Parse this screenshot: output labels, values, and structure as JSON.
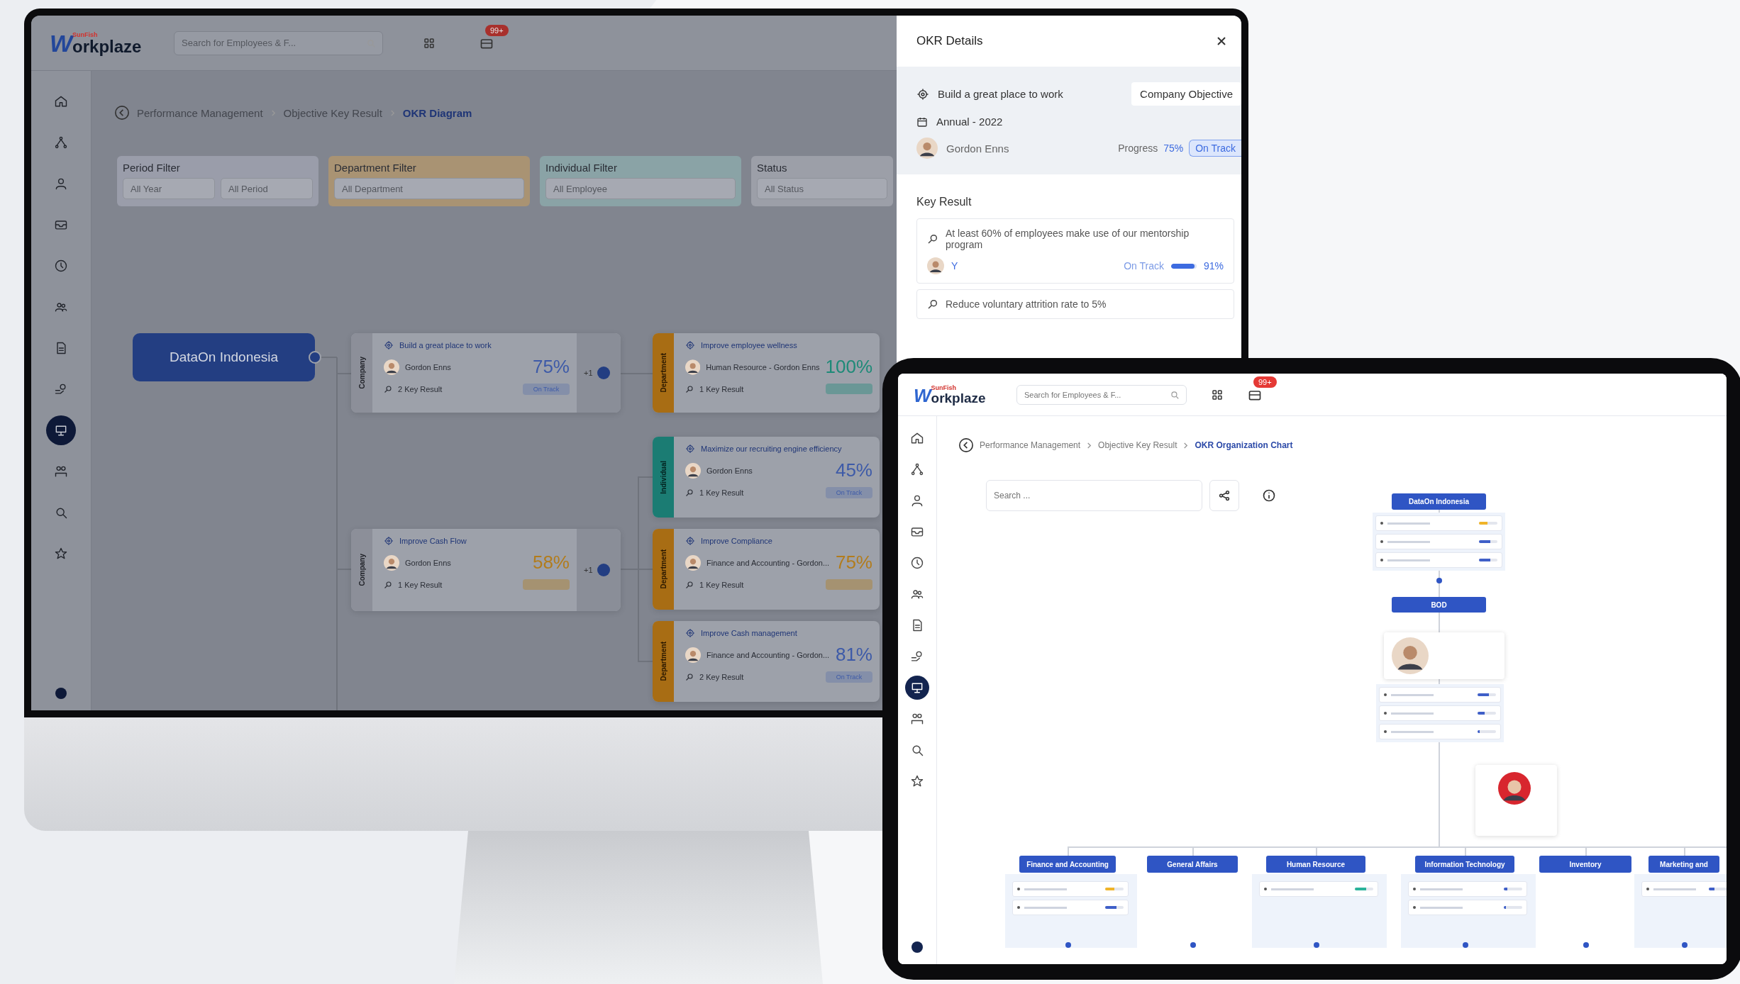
{
  "monitor": {
    "header": {
      "logo": {
        "mark": "W",
        "wordmark": "orkplaze",
        "brand": "SunFish"
      },
      "search": {
        "placeholder": "Search for Employees & F..."
      },
      "notification_badge": "99+"
    },
    "sidebar": {
      "items": [
        {
          "kind": "home",
          "selected": false
        },
        {
          "kind": "network",
          "selected": false
        },
        {
          "kind": "person",
          "selected": false
        },
        {
          "kind": "inbox",
          "selected": false
        },
        {
          "kind": "clock",
          "selected": false
        },
        {
          "kind": "team",
          "selected": false
        },
        {
          "kind": "document",
          "selected": false
        },
        {
          "kind": "coins",
          "selected": false
        },
        {
          "kind": "presentation",
          "selected": true
        },
        {
          "kind": "people",
          "selected": false
        },
        {
          "kind": "magnifier",
          "selected": false
        },
        {
          "kind": "star",
          "selected": false
        }
      ]
    },
    "breadcrumb": [
      "Performance Management",
      "Objective Key Result",
      "OKR Diagram"
    ],
    "filters": [
      {
        "label": "Period Filter",
        "color": "#9a9daa",
        "selects": [
          "All Year",
          "All Period"
        ]
      },
      {
        "label": "Department Filter",
        "color": "#a99373",
        "selects": [
          "All Department"
        ]
      },
      {
        "label": "Individual Filter",
        "color": "#8aa3a6",
        "selects": [
          "All Employee"
        ]
      },
      {
        "label": "Status",
        "color": "#9c9fa8",
        "selects": [
          "All Status"
        ]
      }
    ],
    "diagram": {
      "root": "DataOn Indonesia",
      "objectives": [
        {
          "kind": "company",
          "tier_label": "Company",
          "title": "Build a great place to work",
          "owner": "Gordon Enns",
          "percent": "75%",
          "key_results": "2 Key Result",
          "color": "#3d5aa8",
          "status_label": "On Track",
          "children_count": "+1",
          "children": [
            {
              "kind": "department",
              "tier_label": "Department",
              "title": "Improve employee wellness",
              "owner": "Human Resource - Gordon Enns",
              "percent": "100%",
              "key_results": "1 Key Result",
              "color": "#1e8a78"
            }
          ]
        },
        {
          "kind": "company",
          "tier_label": "Company",
          "title": "Improve Cash Flow",
          "owner": "Gordon Enns",
          "percent": "58%",
          "key_results": "1 Key Result",
          "color": "#b27c1c",
          "children_count": "+1",
          "children": [
            {
              "kind": "individual",
              "tier_label": "Individual",
              "title": "Maximize our recruiting engine efficiency",
              "owner": "Gordon Enns",
              "percent": "45%",
              "key_results": "1 Key Result",
              "color": "#3d5aa8",
              "status_label": "On Track"
            },
            {
              "kind": "department",
              "tier_label": "Department",
              "title": "Improve Compliance",
              "owner": "Finance and Accounting - Gordon...",
              "percent": "75%",
              "key_results": "1 Key Result",
              "color": "#b27c1c"
            },
            {
              "kind": "department",
              "tier_label": "Department",
              "title": "Improve Cash management",
              "owner": "Finance and Accounting - Gordon...",
              "percent": "81%",
              "key_results": "2 Key Result",
              "color": "#3d5aa8",
              "status_label": "On Track"
            }
          ]
        }
      ]
    },
    "details": {
      "title": "OKR Details",
      "objective": "Build a great place to work",
      "tag": "Company Objective",
      "period": "Annual - 2022",
      "owner": "Gordon Enns",
      "progress_label": "Progress",
      "progress": "75%",
      "status_label": "On Track",
      "section": "Key Result",
      "key_results": [
        {
          "text": "At least 60% of employees make use of our mentorship program",
          "owner_initial": "Y",
          "status_label": "On Track",
          "level": 0.91,
          "percent": "91%"
        },
        {
          "text": "Reduce voluntary attrition rate to 5%"
        }
      ]
    }
  },
  "tablet": {
    "header": {
      "logo": {
        "mark": "W",
        "wordmark": "orkplaze",
        "brand": "SunFish"
      },
      "search": {
        "placeholder": "Search for Employees & F..."
      },
      "notification_badge": "99+"
    },
    "sidebar": {
      "items": [
        {
          "kind": "home",
          "selected": false
        },
        {
          "kind": "network",
          "selected": false
        },
        {
          "kind": "person",
          "selected": false
        },
        {
          "kind": "inbox",
          "selected": false
        },
        {
          "kind": "clock",
          "selected": false
        },
        {
          "kind": "team",
          "selected": false
        },
        {
          "kind": "document",
          "selected": false
        },
        {
          "kind": "coins",
          "selected": false
        },
        {
          "kind": "presentation",
          "selected": true
        },
        {
          "kind": "people",
          "selected": false
        },
        {
          "kind": "magnifier",
          "selected": false
        },
        {
          "kind": "star",
          "selected": false
        }
      ]
    },
    "breadcrumb": [
      "Performance Management",
      "Objective Key Result",
      "OKR Organization Chart"
    ],
    "search": {
      "placeholder": "Search ..."
    },
    "org_chart": {
      "top_unit": {
        "label": "DataOn Indonesia",
        "rows": [
          {
            "level": 0.45,
            "color": "#f0b429"
          },
          {
            "level": 0.6,
            "color": "#3f5fc8"
          },
          {
            "level": 0.6,
            "color": "#3f5fc8"
          }
        ]
      },
      "board": {
        "label": "BOD"
      },
      "person": {
        "rows": [
          {
            "level": 0.6,
            "color": "#3f5fc8"
          },
          {
            "level": 0.4,
            "color": "#3f5fc8"
          },
          {
            "level": 0.1,
            "color": "#3f5fc8"
          }
        ]
      },
      "departments": [
        {
          "label": "Finance and Accounting",
          "rows": [
            {
              "level": 0.5,
              "color": "#f0b429"
            },
            {
              "level": 0.6,
              "color": "#3f5fc8"
            }
          ]
        },
        {
          "label": "General Affairs"
        },
        {
          "label": "Human Resource",
          "rows": [
            {
              "level": 0.6,
              "color": "#2bb39a"
            }
          ]
        },
        {
          "label": "Information Technology",
          "rows": [
            {
              "level": 0.2,
              "color": "#3f5fc8"
            },
            {
              "level": 0.1,
              "color": "#3f5fc8"
            }
          ]
        },
        {
          "label": "Inventory"
        },
        {
          "label": "Marketing and",
          "rows": [
            {
              "level": 0.3,
              "color": "#3f5fc8"
            }
          ]
        }
      ]
    }
  }
}
